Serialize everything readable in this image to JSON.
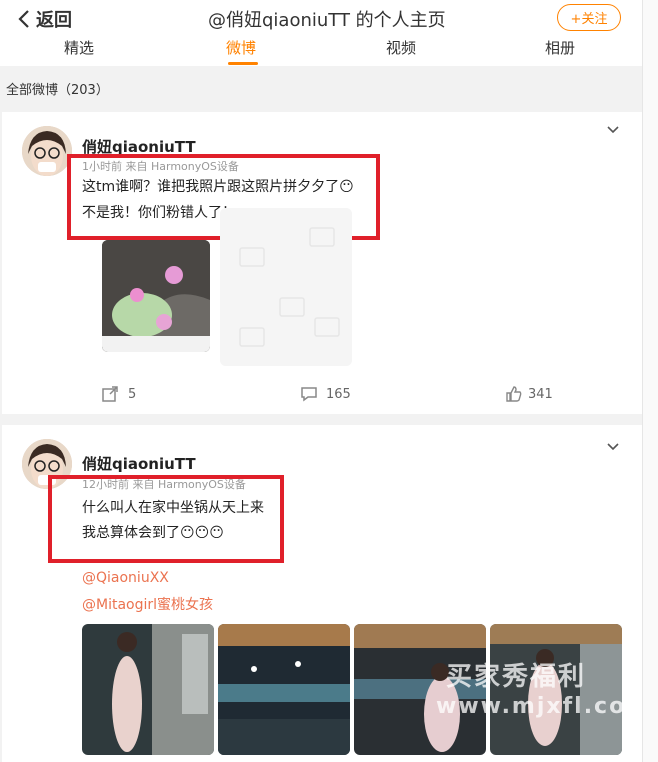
{
  "header": {
    "back_label": "返回",
    "title": "@俏妞qiaoniuTT 的个人主页",
    "follow_label": "+关注",
    "tabs": [
      "精选",
      "微博",
      "视频",
      "相册"
    ],
    "active_tab": "微博"
  },
  "count_label": "全部微博（203）",
  "posts": [
    {
      "username": "俏妞qiaoniuTT",
      "meta": "1小时前  来自 HarmonyOS设备",
      "lines": [
        "这tm谁啊？谁把我照片跟这照片拼夕夕了😶",
        "不是我！你们粉错人了！"
      ],
      "actions": {
        "repost": "5",
        "comment": "165",
        "like": "341"
      }
    },
    {
      "username": "俏妞qiaoniuTT",
      "meta": "12小时前  来自 HarmonyOS设备",
      "lines": [
        "什么叫人在家中坐锅从天上来",
        "我总算体会到了😶😶😶"
      ],
      "mentions": [
        "@QiaoniuXX",
        "@Mitaogirl蜜桃女孩"
      ]
    }
  ],
  "watermark": {
    "line1": "买家秀福利",
    "line2": "www.mjxfl.com"
  },
  "colors": {
    "accent": "#ff8200",
    "mention": "#eb7350",
    "highlight_box": "#e0202a"
  }
}
